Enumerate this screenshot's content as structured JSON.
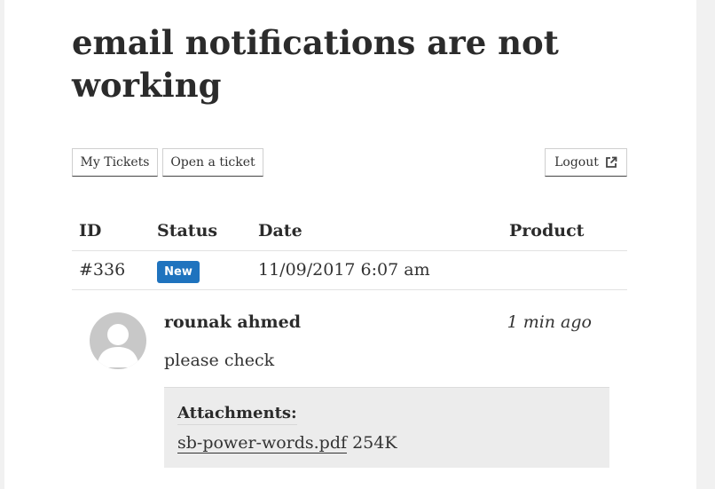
{
  "ticket": {
    "title": "email notifications are not working"
  },
  "nav": {
    "my_tickets": "My Tickets",
    "open_ticket": "Open a ticket",
    "logout": "Logout",
    "logout_icon": "external-link-icon"
  },
  "table": {
    "headers": {
      "id": "ID",
      "status": "Status",
      "date": "Date",
      "product": "Product"
    },
    "row": {
      "id": "#336",
      "status": "New",
      "date": "11/09/2017 6:07 am",
      "product": ""
    }
  },
  "reply": {
    "avatar_icon": "user-avatar-icon",
    "author": "rounak ahmed",
    "time": "1 min ago",
    "message": "please check",
    "attachments": {
      "title": "Attachments:",
      "file_name": "sb-power-words.pdf",
      "file_size": "254K"
    }
  },
  "colors": {
    "badge_new": "#1f73be",
    "attachment_bg": "#ececec"
  }
}
